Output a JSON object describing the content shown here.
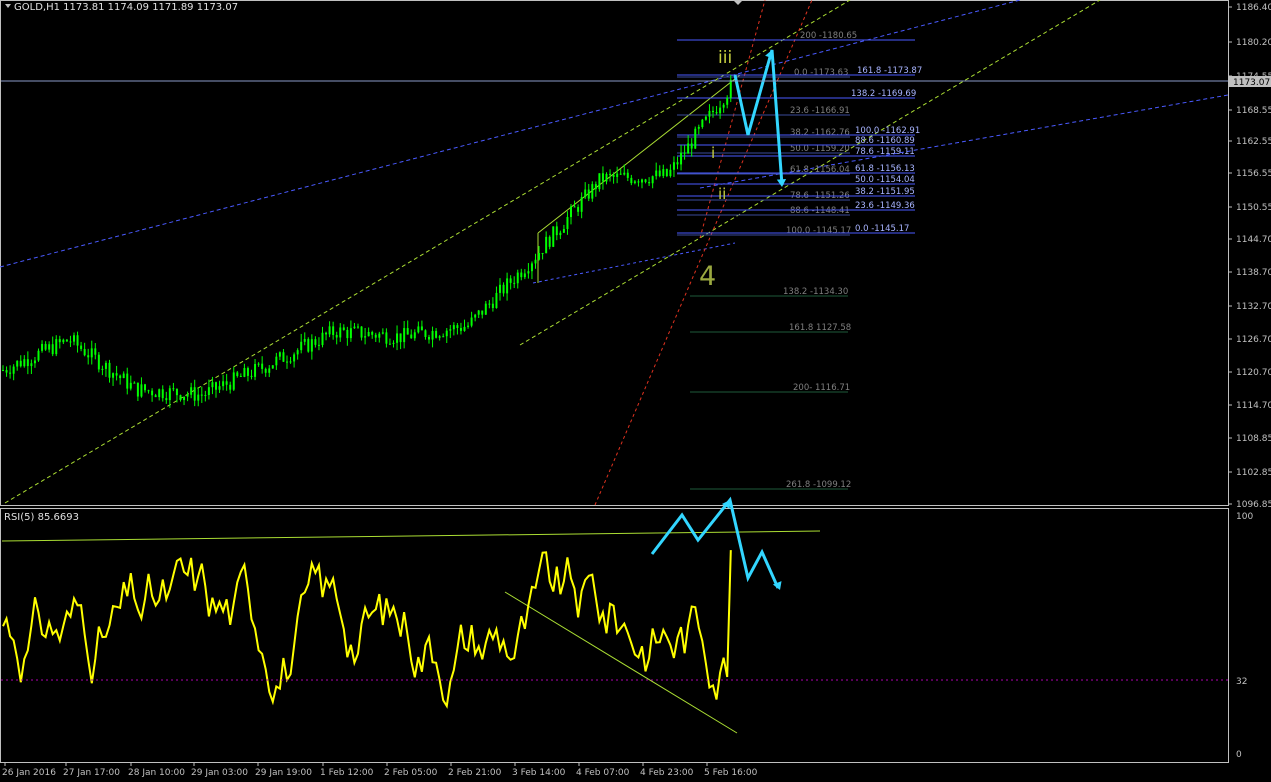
{
  "window": {
    "symbol_info": "GOLD,H1  1173.81 1174.09 1171.89 1173.07",
    "current_price": "1173.07"
  },
  "colors": {
    "background": "#000000",
    "candles": "#00ff00",
    "rsi_line": "#ffff00",
    "channel_blue": "#4a5aff",
    "channel_green": "#aadd33",
    "red_line": "#e0321f",
    "projection_arrow": "#33d6ff",
    "wave_labels": "#c8d040",
    "fib_text": "#7f7f7f",
    "fib_text_blue": "#a8b4ff",
    "axis_text": "#c0c0c0"
  },
  "price_axis": {
    "labels": [
      "1186.40",
      "1180.20",
      "1174.55",
      "1168.55",
      "1162.55",
      "1156.55",
      "1150.55",
      "1144.70",
      "1138.70",
      "1132.70",
      "1126.70",
      "1120.70",
      "1114.70",
      "1108.85",
      "1102.85",
      "1096.85"
    ]
  },
  "rsi": {
    "label": "RSI(5) 85.6693",
    "axis_labels": [
      "100",
      "32",
      "0"
    ]
  },
  "time_axis": {
    "labels": [
      "26 Jan 2016",
      "27 Jan 17:00",
      "28 Jan 10:00",
      "29 Jan 03:00",
      "29 Jan 19:00",
      "1 Feb 12:00",
      "2 Feb 05:00",
      "2 Feb 21:00",
      "3 Feb 14:00",
      "4 Feb 07:00",
      "4 Feb 23:00",
      "5 Feb 16:00"
    ]
  },
  "wave_labels": {
    "iii": "iii",
    "i": "i",
    "ii": "ii",
    "four": "4"
  },
  "fib_left": [
    {
      "text": "200 -1180.65"
    },
    {
      "text": "0.0 -1173.63"
    },
    {
      "text": "23.6 -1166.91"
    },
    {
      "text": "38.2 -1162.76"
    },
    {
      "text": "50.0 -1159.20"
    },
    {
      "text": "61.8 -1156.04"
    },
    {
      "text": "78.6 -1151.26"
    },
    {
      "text": "88.6 -1148.41"
    },
    {
      "text": "100.0 -1145.17"
    },
    {
      "text": "138.2 -1134.30"
    },
    {
      "text": "161.8 1127.58"
    },
    {
      "text": "200- 1116.71"
    },
    {
      "text": "261.8 -1099.12"
    }
  ],
  "fib_right": [
    {
      "text": "161.8 -1173.87"
    },
    {
      "text": "138.2 -1169.69"
    },
    {
      "text": "100.0 -1162.91"
    },
    {
      "text": "88.6 -1160.89"
    },
    {
      "text": "78.6 -1159.11"
    },
    {
      "text": "61.8 -1156.13"
    },
    {
      "text": "50.0 -1154.04"
    },
    {
      "text": "38.2 -1151.95"
    },
    {
      "text": "23.6 -1149.36"
    },
    {
      "text": "0.0 -1145.17"
    }
  ],
  "chart_data": [
    {
      "type": "candlestick",
      "title": "GOLD,H1",
      "price_range": [
        1096.85,
        1186.4
      ],
      "last_price": 1173.07,
      "approx_close_path": [
        {
          "x": "26 Jan 2016",
          "y": 1121.0
        },
        {
          "x": "27 Jan 17:00",
          "y": 1126.5
        },
        {
          "x": "28 Jan 10:00",
          "y": 1117.5
        },
        {
          "x": "29 Jan 03:00",
          "y": 1116.5
        },
        {
          "x": "29 Jan 19:00",
          "y": 1122.0
        },
        {
          "x": "1 Feb 12:00",
          "y": 1128.0
        },
        {
          "x": "2 Feb 05:00",
          "y": 1127.0
        },
        {
          "x": "2 Feb 21:00",
          "y": 1129.0
        },
        {
          "x": "3 Feb 14:00",
          "y": 1141.5
        },
        {
          "x": "4 Feb 07:00",
          "y": 1155.5
        },
        {
          "x": "4 Feb 23:00",
          "y": 1156.0
        },
        {
          "x": "5 Feb 16:00",
          "y": 1173.0
        }
      ]
    },
    {
      "type": "line",
      "title": "RSI(5) 85.6693",
      "ylim": [
        0,
        100
      ],
      "levels": [
        32,
        100
      ],
      "current": 85.6693
    }
  ]
}
